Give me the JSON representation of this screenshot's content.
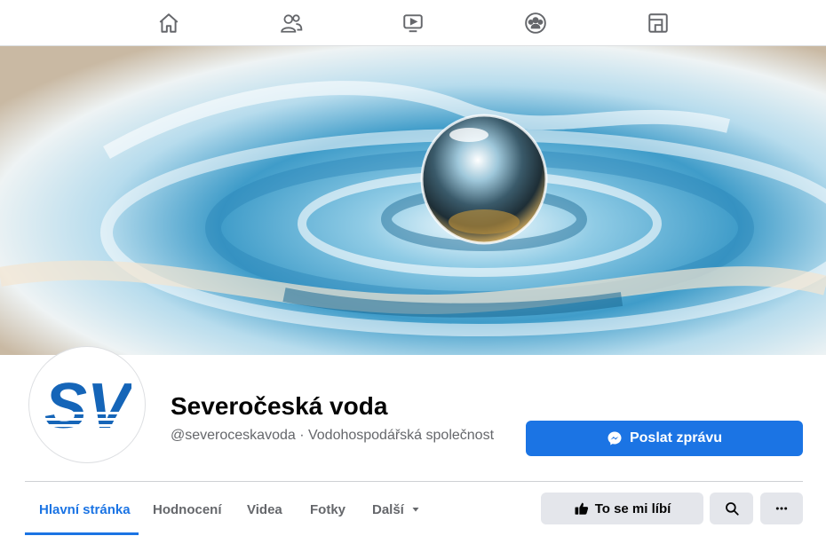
{
  "nav": {
    "items": [
      {
        "icon": "home-icon"
      },
      {
        "icon": "friends-icon"
      },
      {
        "icon": "watch-icon"
      },
      {
        "icon": "groups-icon"
      },
      {
        "icon": "gaming-icon"
      }
    ]
  },
  "page": {
    "name": "Severočeská voda",
    "subtitle": "@severoceskavoda · Vodohospodářská společnost",
    "logo_text": "SV"
  },
  "actions": {
    "message_label": "Poslat zprávu",
    "like_label": "To se mi líbí"
  },
  "tabs": [
    {
      "label": "Hlavní stránka",
      "active": true
    },
    {
      "label": "Hodnocení",
      "active": false
    },
    {
      "label": "Videa",
      "active": false
    },
    {
      "label": "Fotky",
      "active": false
    },
    {
      "label": "Další",
      "active": false
    }
  ],
  "colors": {
    "accent": "#1b74e4",
    "logo_blue": "#1565b8"
  }
}
